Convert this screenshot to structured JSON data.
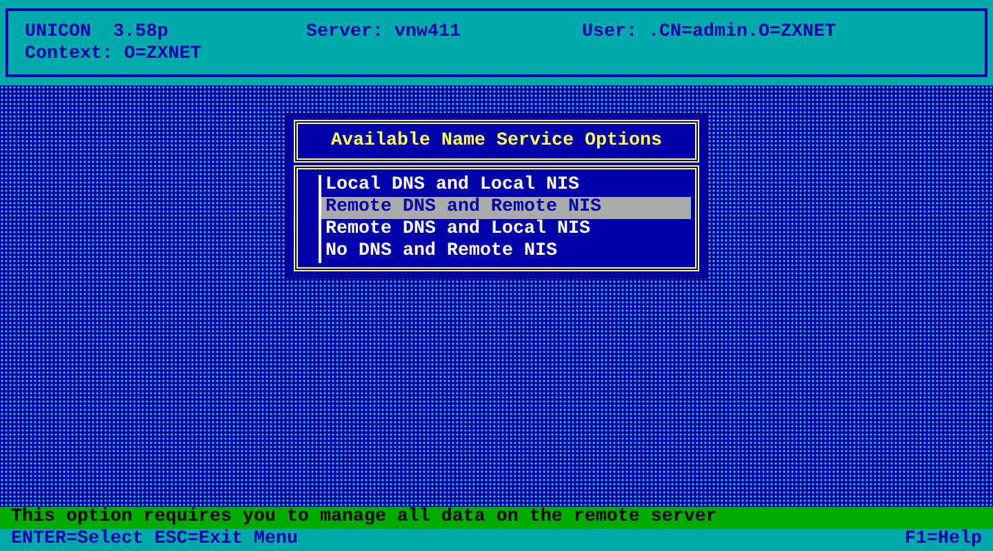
{
  "header": {
    "items": [
      "UNICON  3.58p",
      "Server: vnw411",
      "User: .CN=admin.O=ZXNET",
      "Context: O=ZXNET"
    ]
  },
  "dialog": {
    "title": "Available Name Service Options",
    "options": [
      {
        "label": "Local DNS and Local NIS",
        "selected": false
      },
      {
        "label": "Remote DNS and Remote NIS",
        "selected": true
      },
      {
        "label": "Remote DNS and Local NIS",
        "selected": false
      },
      {
        "label": "No DNS and Remote NIS",
        "selected": false
      }
    ]
  },
  "status_message": "This option requires you to manage all data on the remote server",
  "key_bar": {
    "left": "ENTER=Select ESC=Exit Menu",
    "right": "F1=Help"
  }
}
